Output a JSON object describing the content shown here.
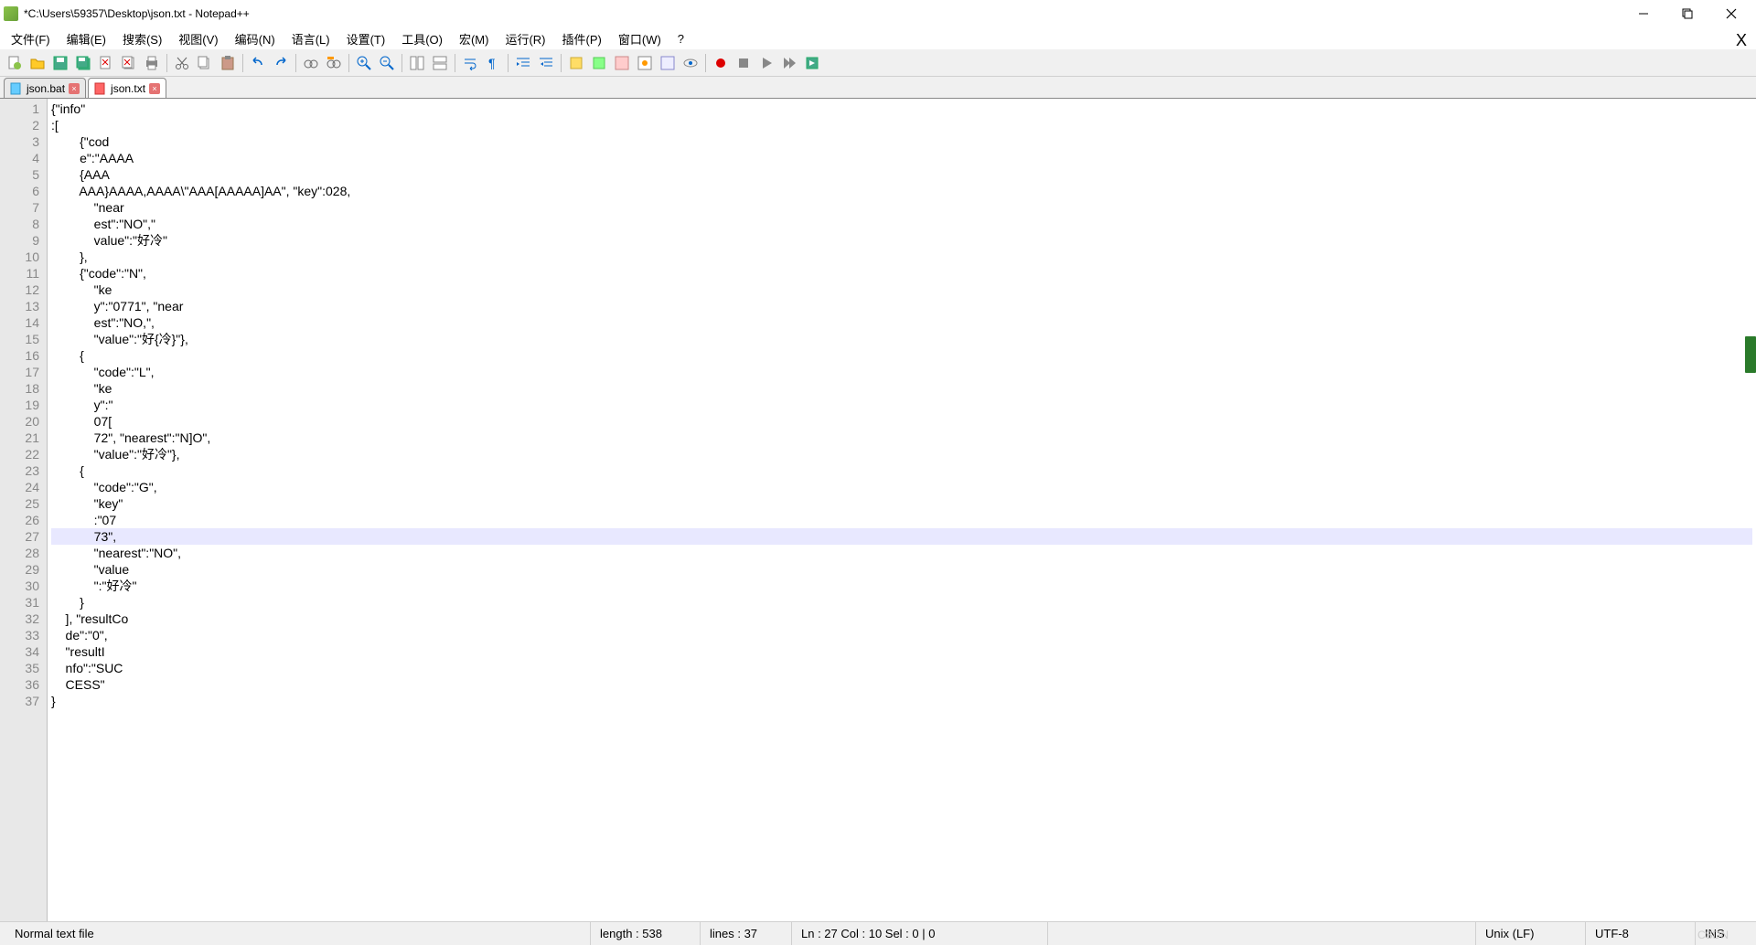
{
  "window": {
    "title": "*C:\\Users\\59357\\Desktop\\json.txt - Notepad++"
  },
  "menu": {
    "file": "文件(F)",
    "edit": "编辑(E)",
    "search": "搜索(S)",
    "view": "视图(V)",
    "encoding": "编码(N)",
    "language": "语言(L)",
    "settings": "设置(T)",
    "tools": "工具(O)",
    "macro": "宏(M)",
    "run": "运行(R)",
    "plugins": "插件(P)",
    "window_menu": "窗口(W)",
    "help": "?"
  },
  "toolbar": {
    "icons": [
      "new",
      "open",
      "save",
      "save-all",
      "close",
      "close-all",
      "print",
      "cut",
      "copy",
      "paste",
      "undo",
      "redo",
      "find",
      "replace",
      "zoom-in",
      "zoom-out",
      "sync-v",
      "sync-h",
      "word-wrap",
      "all-chars",
      "indent",
      "outdent",
      "fold",
      "unfold",
      "function-list",
      "doc-map",
      "doc-switcher",
      "monitoring",
      "record-macro",
      "stop-macro",
      "play-macro",
      "play-multi",
      "save-macro"
    ]
  },
  "tabs": [
    {
      "label": "json.bat",
      "modified": false,
      "active": false
    },
    {
      "label": "json.txt",
      "modified": true,
      "active": true
    }
  ],
  "editor": {
    "highlighted_line_index": 26,
    "lines": [
      "{\"info\"",
      ":[",
      "        {\"cod",
      "        e\":\"AAAA",
      "        {AAA",
      "        AAA}AAAA,AAAA\\\"AAA[AAAAA]AA\", \"key\":028,",
      "            \"near",
      "            est\":\"NO\",\"",
      "            value\":\"好冷\"",
      "        },",
      "        {\"code\":\"N\",",
      "            \"ke",
      "            y\":\"0771\", \"near",
      "            est\":\"NO,\",",
      "            \"value\":\"好{冷}\"},",
      "        {",
      "            \"code\":\"L\",",
      "            \"ke",
      "            y\":\"",
      "            07[",
      "            72\", \"nearest\":\"N]O\",",
      "            \"value\":\"好冷\"},",
      "        {",
      "            \"code\":\"G\",",
      "            \"key\"",
      "            :\"07",
      "            73\",",
      "            \"nearest\":\"NO\",",
      "            \"value",
      "            \":\"好冷\"",
      "        }",
      "    ], \"resultCo",
      "    de\":\"0\",",
      "    \"resultI",
      "    nfo\":\"SUC",
      "    CESS\"",
      "}"
    ]
  },
  "status": {
    "file_type": "Normal text file",
    "length_label": "length : 538",
    "lines_label": "lines : 37",
    "pos_label": "Ln : 27   Col : 10   Sel : 0 | 0",
    "eol": "Unix (LF)",
    "encoding": "UTF-8",
    "ins": "INS"
  },
  "watermark": "CSDN"
}
